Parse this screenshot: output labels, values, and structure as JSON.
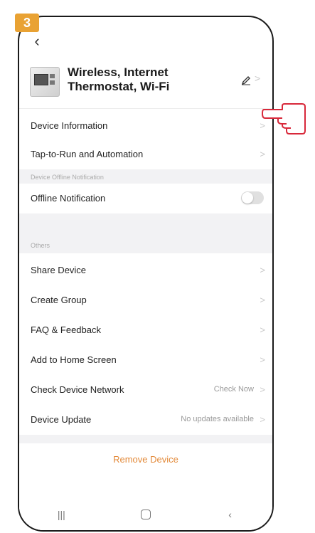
{
  "step_badge": "3",
  "header": {
    "device_name": "Wireless, Internet Thermostat, Wi-Fi"
  },
  "rows": {
    "device_information": "Device Information",
    "tap_to_run": "Tap-to-Run and Automation",
    "offline_section_title": "Device Offline Notification",
    "offline_notification": "Offline Notification",
    "others_section_title": "Others",
    "share_device": "Share Device",
    "create_group": "Create Group",
    "faq_feedback": "FAQ & Feedback",
    "add_home_screen": "Add to Home Screen",
    "check_network": "Check Device Network",
    "check_network_value": "Check Now",
    "device_update": "Device Update",
    "device_update_value": "No updates available"
  },
  "remove_device": "Remove Device",
  "offline_notification_enabled": false,
  "icons": {
    "back": "back-arrow-icon",
    "edit": "pencil-icon",
    "chevron": "chevron-right-icon",
    "nav_recents": "recents-icon",
    "nav_home": "home-icon",
    "nav_back": "back-icon",
    "pointer": "pointing-hand-icon"
  },
  "colors": {
    "accent": "#e38a3a",
    "badge": "#e9a233",
    "section_bg": "#f2f2f4"
  }
}
